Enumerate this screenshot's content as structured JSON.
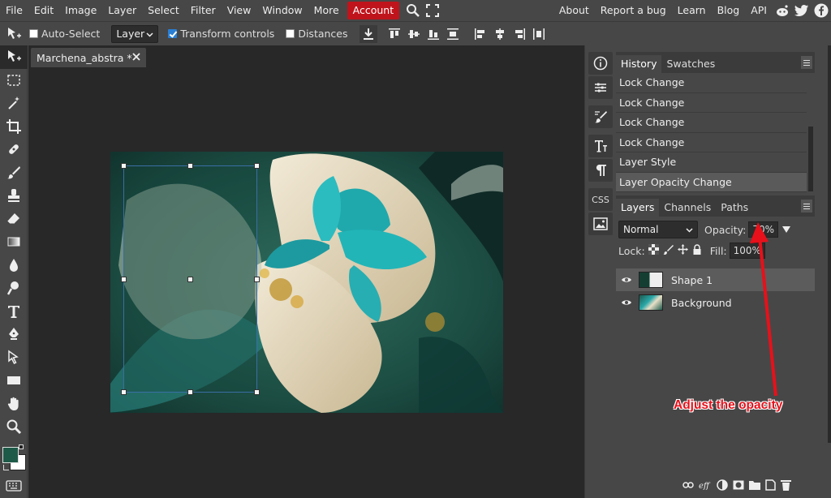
{
  "menu": {
    "items": [
      "File",
      "Edit",
      "Image",
      "Layer",
      "Select",
      "Filter",
      "View",
      "Window",
      "More"
    ],
    "account": "Account",
    "right": [
      "About",
      "Report a bug",
      "Learn",
      "Blog",
      "API"
    ]
  },
  "options": {
    "auto_select": "Auto-Select",
    "layer_select": "Layer",
    "transform_controls": "Transform controls",
    "distances": "Distances"
  },
  "document": {
    "tab_title": "Marchena_abstra *"
  },
  "history": {
    "tabs": [
      "History",
      "Swatches"
    ],
    "items": [
      "Lock Change",
      "Lock Change",
      "Lock Change",
      "Lock Change",
      "Layer Style",
      "Layer Opacity Change"
    ]
  },
  "layers": {
    "tabs": [
      "Layers",
      "Channels",
      "Paths"
    ],
    "blend_mode": "Normal",
    "opacity_label": "Opacity:",
    "opacity_value": "70%",
    "lock_label": "Lock:",
    "fill_label": "Fill:",
    "fill_value": "100%",
    "items": [
      "Shape 1",
      "Background"
    ]
  },
  "side": {
    "css_label": "CSS"
  },
  "annotation": "Adjust the opacity",
  "colors": {
    "accent": "#c0141c",
    "annotation": "#e8101a",
    "foreground": "#1e5a48",
    "background": "#ffffff"
  }
}
